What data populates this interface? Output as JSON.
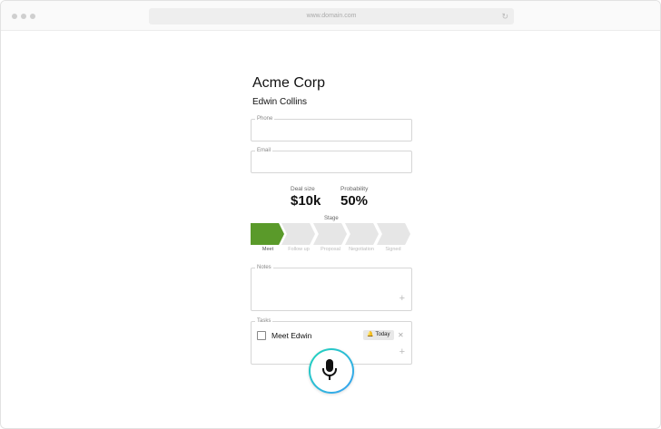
{
  "browser": {
    "url": "www.domain.com",
    "reload_icon": "reload-icon"
  },
  "contact": {
    "company": "Acme Corp",
    "name": "Edwin Collins"
  },
  "fields": {
    "phone": {
      "label": "Phone",
      "value": ""
    },
    "email": {
      "label": "Email",
      "value": ""
    }
  },
  "metrics": {
    "deal_size": {
      "label": "Deal size",
      "value": "$10k"
    },
    "probability": {
      "label": "Probability",
      "value": "50%"
    }
  },
  "stage": {
    "title": "Stage",
    "steps": [
      "Meet",
      "Follow up",
      "Proposal",
      "Negotiation",
      "Signed"
    ],
    "active_step": "Meet",
    "active_color": "#5a9a2a"
  },
  "notes": {
    "label": "Notes",
    "add_icon": "plus-icon"
  },
  "tasks": {
    "label": "Tasks",
    "items": [
      {
        "text": "Meet Edwin",
        "due": "Today",
        "checked": false
      }
    ],
    "add_icon": "plus-icon"
  },
  "mic": {
    "icon": "microphone-icon",
    "accent_start": "#1fd6b9",
    "accent_end": "#3aa0f5"
  }
}
